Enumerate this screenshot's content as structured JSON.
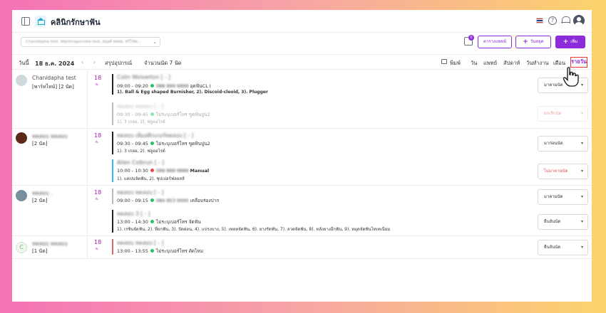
{
  "app": {
    "title": "คลินิกรักษาฟัน"
  },
  "filter": {
    "placeholder": "Chanidapha test, Wachirapornlee test, อนงค์ พลอย, ทวีโชค..."
  },
  "actions": {
    "inbox_badge": "0",
    "btn_doctor_schedule": "ตารางแพทย์",
    "btn_holiday": "วันหยุด",
    "btn_add": "เพิ่ม"
  },
  "toolbar": {
    "today_label": "วันนี้",
    "date": "18 ธ.ค. 2024",
    "summary_label": "สรุปอุปกรณ์",
    "appointment_count": "จำนวนนัด 7 นัด",
    "print": "พิมพ์",
    "views": [
      "วัน",
      "แพทย์",
      "สัปดาห์",
      "วันทำงาน",
      "เดือน",
      "รายวัน"
    ]
  },
  "rows": [
    {
      "doctor_name": "Chanidapha test",
      "doctor_sub": "[พาร์ทไทม์] [2 นัด]",
      "day": "18",
      "month": "ธ.",
      "appointments": [
        {
          "patient": "Colin Wolverton [ - ]",
          "time": "09:00 - 09:20",
          "phone": "088 999 9999",
          "room": "อุดฟันCL I",
          "items": "1). Ball & Egg shaped Burnisher, 2). Discoid-cleoid, 3). Plugger",
          "status": "มาตามนัด"
        },
        {
          "patient": "ทดสอบ ทดสอบ [ - ]",
          "time": "09:30 - 09:45",
          "phone": "ไม่ระบุเบอร์โทร",
          "room": "ขูดหินปูน2",
          "items": "1). 3 เกลอ, 2). ฟลูออไรด์",
          "status": "ยกเลิกนัด"
        }
      ]
    },
    {
      "doctor_name": "ทดสอบ ทดสอบ",
      "doctor_sub": "[2 นัด]",
      "day": "18",
      "month": "ธ.",
      "appointments": [
        {
          "patient": "ทดสอบ เพิ่มสติกเกอร์ทดสอบ [ - ]",
          "time": "09:30 - 09:45",
          "phone": "ไม่ระบุเบอร์โทร",
          "room": "ขูดหินปูน2",
          "items": "1). 3 เกลอ, 2). ฟลูออไรด์",
          "status": "มาก่อนนัด"
        },
        {
          "patient": "Allen Colbrun [ - ]",
          "time": "10:00 - 10:30",
          "phone": "099 999 9999",
          "room": "Manual",
          "items": "1). แคปนจัดฟัน, 2). ชุปเปอร์ฟลอสส์",
          "status": "ไม่มาตามนัด"
        }
      ]
    },
    {
      "doctor_name": "ทดสอบ .",
      "doctor_sub": "[2 นัด]",
      "day": "18",
      "month": "ธ.",
      "appointments": [
        {
          "patient": "ทดสอบ ทดสอบ [ - ]",
          "time": "09:00 - 09:15",
          "phone": "084 953 0000",
          "room": "เคลือบร่องปาก",
          "items": "",
          "status": "มาตามนัด"
        },
        {
          "patient": "ทดสอบ 3 [ - ]",
          "time": "13:00 - 14:30",
          "phone": "ไม่ระบุเบอร์โทร",
          "room": "จัดฟัน",
          "items": "1). เรซินจัดฟัน, 2). ที่ยกฟัน, 3). ปัดฝอน, 4). แปรงบาง, 5). เพลทจัดฟัน, 6). ยางรัดฟัน, 7). ลวดจัดฟัน, 8). หลังยางอีกฟัน, 9). หมุดจัดฟันไทเทเนียม",
          "status": "ยืนยันนัด"
        }
      ]
    },
    {
      "doctor_name": "ทดสอบ ทดสอบ",
      "doctor_sub": "[1 นัด]",
      "day": "18",
      "month": "ธ.",
      "appointments": [
        {
          "patient": "ทดสอบ ทดสอบ [ - ]",
          "time": "13:00 - 13:55",
          "phone": "ไม่ระบุเบอร์โทร",
          "room": "ตัดไหม",
          "items": "",
          "status": "ยืนยันนัด"
        }
      ]
    }
  ]
}
